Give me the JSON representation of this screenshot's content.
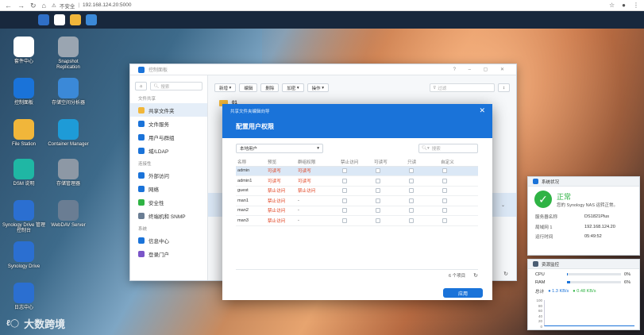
{
  "browser": {
    "security": "不安全",
    "url": "192.168.124.20:5000"
  },
  "desktop_icons": [
    {
      "label": "套件中心",
      "name": "package-center-icon",
      "color": "#ffffff"
    },
    {
      "label": "Snapshot Replication",
      "name": "snapshot-replication-icon",
      "color": "#9aa5b1"
    },
    {
      "label": "控制面板",
      "name": "control-panel-icon",
      "color": "#1a73d9"
    },
    {
      "label": "存储空间分析器",
      "name": "storage-analyzer-icon",
      "color": "#3b89d8"
    },
    {
      "label": "File Station",
      "name": "file-station-icon",
      "color": "#f1b63a"
    },
    {
      "label": "Container Manager",
      "name": "container-manager-icon",
      "color": "#1e9bd7"
    },
    {
      "label": "DSM 说明",
      "name": "dsm-help-icon",
      "color": "#1fb7a4"
    },
    {
      "label": "存储管理器",
      "name": "storage-manager-icon",
      "color": "#8d98a5"
    },
    {
      "label": "Synology Drive 管理控制台",
      "name": "drive-admin-console-icon",
      "color": "#2b6fd1"
    },
    {
      "label": "WebDAV Server",
      "name": "webdav-server-icon",
      "color": "#6a7d93"
    },
    {
      "label": "Synology Drive",
      "name": "synology-drive-icon",
      "color": "#2b6fd1"
    },
    {
      "label": "日志中心",
      "name": "log-center-icon",
      "color": "#2b6fd1"
    }
  ],
  "control_panel": {
    "title": "控制面板",
    "search_placeholder": "搜索",
    "sections": [
      {
        "title": "文件共享",
        "items": [
          "共享文件夹",
          "文件服务",
          "用户与群组",
          "域/LDAP"
        ]
      },
      {
        "title": "连接性",
        "items": [
          "外部访问",
          "网络",
          "安全性",
          "终端机和 SNMP"
        ]
      },
      {
        "title": "系统",
        "items": [
          "信息中心",
          "登录门户"
        ]
      }
    ],
    "toolbar": {
      "new": "新增",
      "edit": "编辑",
      "delete": "删除",
      "encrypt": "加密",
      "action": "操作",
      "filter_placeholder": "过滤"
    },
    "folder_first": "01"
  },
  "dialog": {
    "subtitle": "共享文件夹编辑向导",
    "title": "配置用户权限",
    "scope": "本地用户",
    "search_placeholder": "搜索",
    "columns": [
      "名称",
      "预览",
      "群组权限",
      "禁止访问",
      "可读写",
      "只读",
      "自定义"
    ],
    "rows": [
      {
        "name": "admin",
        "preview": "可读写",
        "group": "可读写"
      },
      {
        "name": "admin1",
        "preview": "可读写",
        "group": "可读写"
      },
      {
        "name": "guest",
        "preview": "禁止访问",
        "group": "禁止访问"
      },
      {
        "name": "man1",
        "preview": "禁止访问",
        "group": "-"
      },
      {
        "name": "man2",
        "preview": "禁止访问",
        "group": "-"
      },
      {
        "name": "man3",
        "preview": "禁止访问",
        "group": "-"
      }
    ],
    "count": "6 个项目",
    "apply": "应用"
  },
  "system_status": {
    "title": "系统状况",
    "status": "正常",
    "message": "您的 Synology NAS 运转正常。",
    "rows": [
      {
        "k": "服务器名称",
        "v": "DS1821Plus"
      },
      {
        "k": "局域网 1",
        "v": "192.168.124.20"
      },
      {
        "k": "运行时间",
        "v": "05:49:52"
      }
    ],
    "ok_color": "#2fb344"
  },
  "resource_monitor": {
    "title": "资源监控",
    "cpu_label": "CPU",
    "cpu": "0%",
    "cpu_fraction": 0.02,
    "ram_label": "RAM",
    "ram": "6%",
    "ram_fraction": 0.06,
    "total_label": "总计",
    "up": "1.3 KB/s",
    "down": "0.48 KB/s",
    "y_ticks": [
      "100",
      "80",
      "60",
      "40",
      "20",
      "0"
    ]
  },
  "watermark": "大数跨境",
  "accent": "#1a73d9"
}
